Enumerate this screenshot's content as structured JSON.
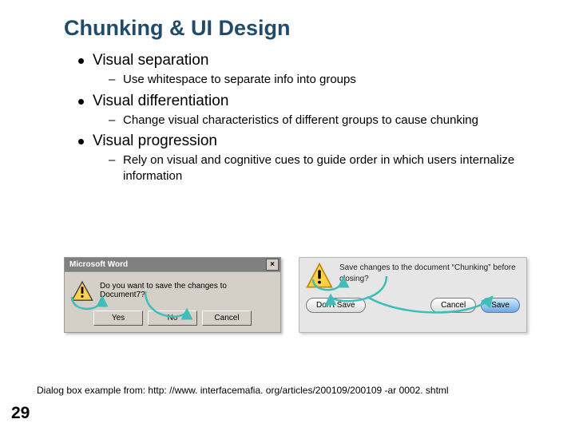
{
  "title": "Chunking & UI Design",
  "bullets": {
    "b1": "Visual separation",
    "b1s": "Use whitespace to separate info into groups",
    "b2": "Visual differentiation",
    "b2s": "Change visual characteristics of different groups to cause chunking",
    "b3": "Visual progression",
    "b3s": "Rely on visual and cognitive cues to guide order in which users internalize information"
  },
  "dlg1": {
    "title": "Microsoft Word",
    "msg": "Do you want to save the changes to Document7?",
    "yes": "Yes",
    "no": "No",
    "cancel": "Cancel"
  },
  "dlg2": {
    "msg": "Save changes to the document “Chunking” before closing?",
    "dontsave": "Don't Save",
    "cancel": "Cancel",
    "save": "Save"
  },
  "footer": "Dialog box example from: http: //www. interfacemafia. org/articles/200109/200109 -ar 0002. shtml",
  "slideNumber": "29",
  "closeGlyph": "×"
}
